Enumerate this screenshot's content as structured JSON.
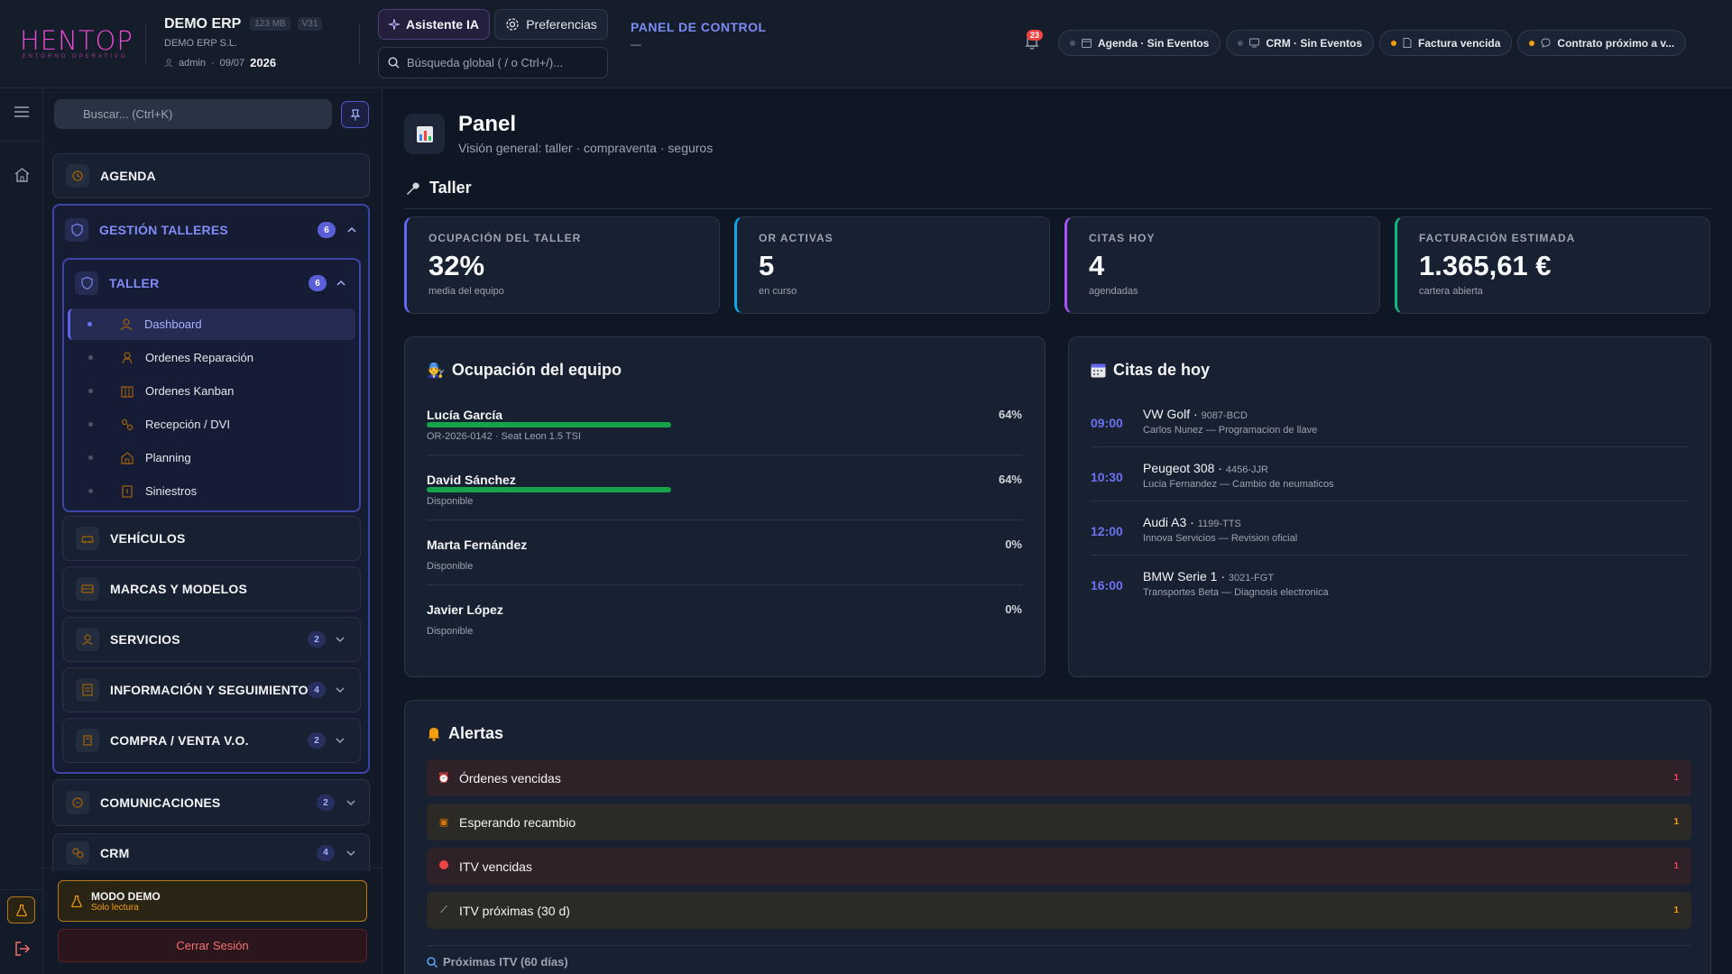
{
  "header": {
    "logo_text": "HENTOP",
    "logo_sub": "ENTORNO OPERATIVO",
    "company_name": "DEMO ERP",
    "mem_badge": "123 MB",
    "version_badge": "V31",
    "company_legal": "DEMO ERP S.L.",
    "user": "admin",
    "date": "09/07",
    "year": "2026",
    "ai_button": "Asistente IA",
    "prefs_button": "Preferencias",
    "search_placeholder": "Búsqueda global ( / o Ctrl+/)...",
    "panel_label": "PANEL DE CONTROL",
    "panel_sub": "—",
    "notifications_count": "23",
    "chips": [
      {
        "label": "Agenda · Sin Eventos",
        "dot_color": "#4b5563",
        "icon": "calendar-icon"
      },
      {
        "label": "CRM · Sin Eventos",
        "dot_color": "#4b5563",
        "icon": "monitor-icon"
      },
      {
        "label": "Factura vencida",
        "dot_color": "#f59e0b",
        "icon": "document-icon"
      },
      {
        "label": "Contrato próximo a v...",
        "dot_color": "#f59e0b",
        "icon": "chat-icon"
      }
    ]
  },
  "sidebar": {
    "search_placeholder": "Buscar... (Ctrl+K)",
    "agenda": "AGENDA",
    "gestion": {
      "label": "GESTIÓN TALLERES",
      "badge": "6"
    },
    "taller": {
      "label": "TALLER",
      "badge": "6"
    },
    "taller_items": [
      {
        "label": "Dashboard",
        "icon": "user-tie-icon"
      },
      {
        "label": "Ordenes Reparación",
        "icon": "mechanic-icon"
      },
      {
        "label": "Ordenes Kanban",
        "icon": "kanban-icon"
      },
      {
        "label": "Recepción / DVI",
        "icon": "reception-icon"
      },
      {
        "label": "Planning",
        "icon": "planning-icon"
      },
      {
        "label": "Siniestros",
        "icon": "claims-icon"
      }
    ],
    "vehiculos": "VEHÍCULOS",
    "marcas": "MARCAS Y MODELOS",
    "servicios": {
      "label": "SERVICIOS",
      "badge": "2"
    },
    "info": {
      "label": "INFORMACIÓN Y SEGUIMIENTO",
      "badge": "4"
    },
    "compraventa": {
      "label": "COMPRA / VENTA V.O.",
      "badge": "2"
    },
    "comunicaciones": {
      "label": "COMUNICACIONES",
      "badge": "2"
    },
    "crm": {
      "label": "CRM",
      "badge": "4"
    },
    "demo_title": "MODO DEMO",
    "demo_sub": "Solo lectura",
    "logout": "Cerrar Sesión"
  },
  "main": {
    "title": "Panel",
    "subtitle": "Visión general: taller · compraventa · seguros",
    "section_taller": "Taller",
    "kpis": [
      {
        "label": "OCUPACIÓN DEL TALLER",
        "value": "32%",
        "note": "media del equipo",
        "accent": "#6366f1"
      },
      {
        "label": "OR ACTIVAS",
        "value": "5",
        "note": "en curso",
        "accent": "#0ea5e9"
      },
      {
        "label": "CITAS HOY",
        "value": "4",
        "note": "agendadas",
        "accent": "#a855f7"
      },
      {
        "label": "FACTURACIÓN ESTIMADA",
        "value": "1.365,61 €",
        "note": "cartera abierta",
        "accent": "#10b981"
      }
    ],
    "team": {
      "title": "Ocupación del equipo",
      "members": [
        {
          "name": "Lucía García",
          "pct_label": "64%",
          "pct": 0.64,
          "note": "OR-2026-0142 · Seat Leon 1.5 TSI"
        },
        {
          "name": "David Sánchez",
          "pct_label": "64%",
          "pct": 0.64,
          "note": "Disponible"
        },
        {
          "name": "Marta Fernández",
          "pct_label": "0%",
          "pct": 0,
          "note": "Disponible"
        },
        {
          "name": "Javier López",
          "pct_label": "0%",
          "pct": 0,
          "note": "Disponible"
        }
      ]
    },
    "appointments": {
      "title": "Citas de hoy",
      "items": [
        {
          "time": "09:00",
          "car": "VW Golf",
          "plate": "9087-BCD",
          "desc": "Carlos Nunez — Programacion de llave"
        },
        {
          "time": "10:30",
          "car": "Peugeot 308",
          "plate": "4456-JJR",
          "desc": "Lucia Fernandez — Cambio de neumaticos"
        },
        {
          "time": "12:00",
          "car": "Audi A3",
          "plate": "1199-TTS",
          "desc": "Innova Servicios — Revision oficial"
        },
        {
          "time": "16:00",
          "car": "BMW Serie 1",
          "plate": "3021-FGT",
          "desc": "Transportes Beta — Diagnosis electronica"
        }
      ]
    },
    "alerts": {
      "title": "Alertas",
      "items": [
        {
          "label": "Órdenes vencidas",
          "count": "1",
          "kind": "red",
          "icon": "alarm-icon"
        },
        {
          "label": "Esperando recambio",
          "count": "1",
          "kind": "amber",
          "icon": "box-icon"
        },
        {
          "label": "ITV vencidas",
          "count": "1",
          "kind": "red",
          "icon": "red-circle-icon"
        },
        {
          "label": "ITV próximas (30 d)",
          "count": "1",
          "kind": "amber",
          "icon": "wrench-icon"
        }
      ],
      "next_itv": "Próximas ITV (60 días)"
    }
  }
}
